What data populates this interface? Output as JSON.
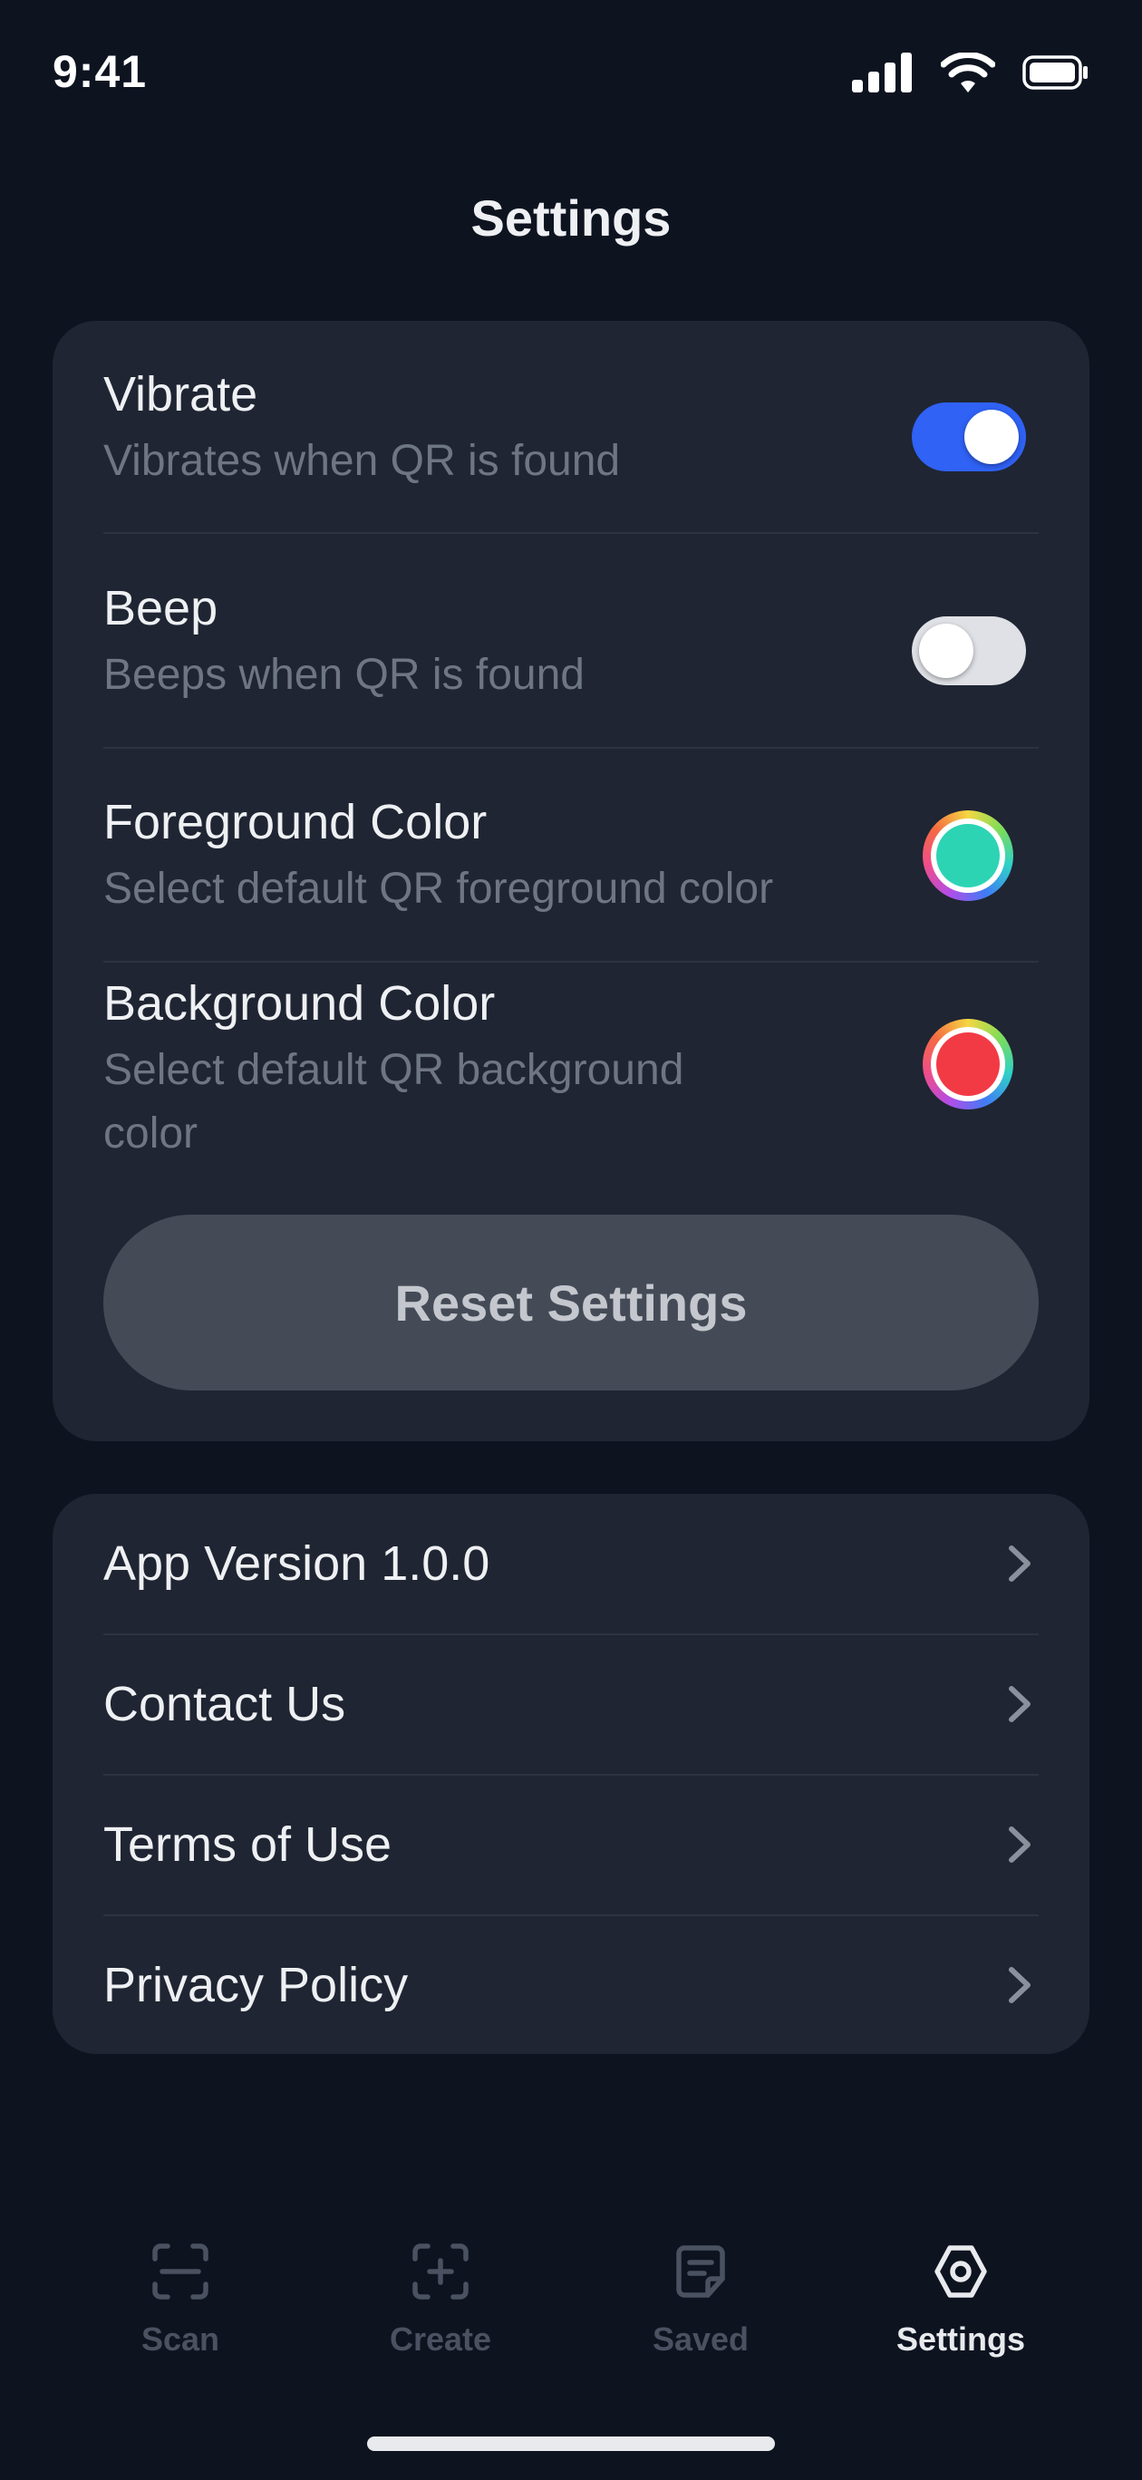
{
  "status_bar": {
    "time": "9:41"
  },
  "header": {
    "title": "Settings"
  },
  "settings": {
    "vibrate": {
      "title": "Vibrate",
      "subtitle": "Vibrates when QR is found",
      "enabled": true
    },
    "beep": {
      "title": "Beep",
      "subtitle": "Beeps when QR is found",
      "enabled": false
    },
    "foreground": {
      "title": "Foreground Color",
      "subtitle": "Select default QR foreground color",
      "color": "#2dd4b4"
    },
    "background": {
      "title": "Background Color",
      "subtitle_line1": "Select default QR background",
      "subtitle_line2": "color",
      "color": "#f23a45"
    },
    "reset_label": "Reset Settings"
  },
  "info": {
    "items": [
      {
        "label": "App Version 1.0.0"
      },
      {
        "label": "Contact Us"
      },
      {
        "label": "Terms of Use"
      },
      {
        "label": "Privacy Policy"
      }
    ]
  },
  "tabs": [
    {
      "label": "Scan",
      "icon": "scan-icon",
      "active": false
    },
    {
      "label": "Create",
      "icon": "create-icon",
      "active": false
    },
    {
      "label": "Saved",
      "icon": "saved-icon",
      "active": false
    },
    {
      "label": "Settings",
      "icon": "settings-icon",
      "active": true
    }
  ],
  "colors": {
    "background": "#0d1420",
    "card": "#1f2532",
    "accent": "#2f62f5",
    "button": "#444b57"
  }
}
